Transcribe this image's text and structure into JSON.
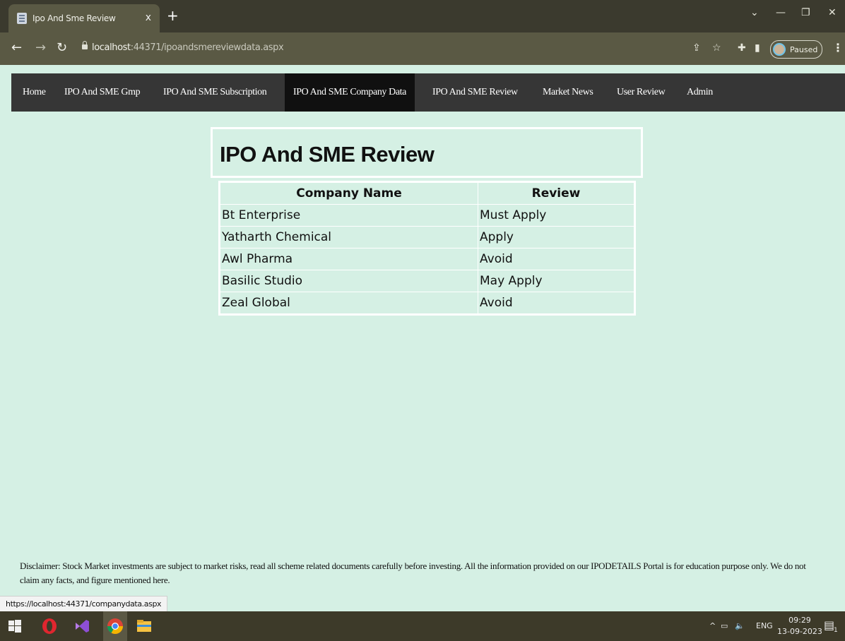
{
  "browser": {
    "tab_title": "Ipo And Sme Review",
    "tab_close": "x",
    "new_tab": "+",
    "url_host": "localhost",
    "url_rest": ":44371/ipoandsmereviewdata.aspx",
    "profile_status": "Paused",
    "status_url": "https://localhost:44371/companydata.aspx"
  },
  "nav": {
    "items": [
      {
        "label": "Home"
      },
      {
        "label": "IPO And SME Gmp"
      },
      {
        "label": "IPO And SME Subscription"
      },
      {
        "label": "IPO And SME Company Data"
      },
      {
        "label": "IPO And SME Review"
      },
      {
        "label": "Market News"
      },
      {
        "label": "User Review"
      },
      {
        "label": "Admin"
      }
    ],
    "active_index": 3
  },
  "page": {
    "title": "IPO And SME Review"
  },
  "table": {
    "headers": [
      "Company Name",
      "Review"
    ],
    "rows": [
      [
        "Bt Enterprise",
        "Must Apply"
      ],
      [
        "Yatharth Chemical",
        "Apply"
      ],
      [
        "Awl Pharma",
        "Avoid"
      ],
      [
        "Basilic Studio",
        "May Apply"
      ],
      [
        "Zeal Global",
        "Avoid"
      ]
    ]
  },
  "footer": {
    "disclaimer": "Disclaimer: Stock Market investments are subject to market risks, read all scheme related documents carefully before investing. All the information provided on our IPODETAILS Portal is for education purpose only. We do not claim any facts, and figure mentioned here."
  },
  "taskbar": {
    "lang": "ENG",
    "time": "09:29",
    "date": "13-09-2023",
    "notification_count": "1"
  },
  "colors": {
    "page_bg": "#d5f0e4",
    "nav_bg": "#363636",
    "nav_active_bg": "#101010"
  }
}
